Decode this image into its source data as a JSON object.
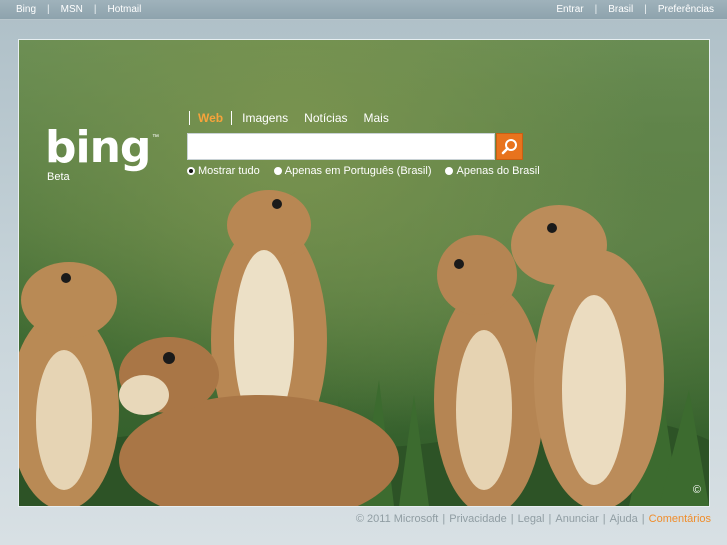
{
  "top_nav": {
    "left": [
      "Bing",
      "MSN",
      "Hotmail"
    ],
    "right": [
      "Entrar",
      "Brasil",
      "Preferências"
    ],
    "separator": "|"
  },
  "logo": {
    "text": "bing",
    "trademark": "™",
    "subtitle": "Beta"
  },
  "search": {
    "tabs": [
      "Web",
      "Imagens",
      "Notícias",
      "Mais"
    ],
    "active_tab": "Web",
    "query_value": "",
    "radio_options": [
      "Mostrar tudo",
      "Apenas em Português (Brasil)",
      "Apenas do Brasil"
    ],
    "selected_option": "Mostrar tudo"
  },
  "image_copyright": "©",
  "footer": {
    "copyright": "© 2011 Microsoft",
    "links": [
      "Privacidade",
      "Legal",
      "Anunciar",
      "Ajuda"
    ],
    "highlight_link": "Comentários",
    "separator": "|"
  },
  "colors": {
    "accent_orange": "#f7a33b",
    "search_button": "#e8731d",
    "footer_highlight": "#f08d2c"
  },
  "icons": {
    "search_button_icon": "search-icon"
  }
}
